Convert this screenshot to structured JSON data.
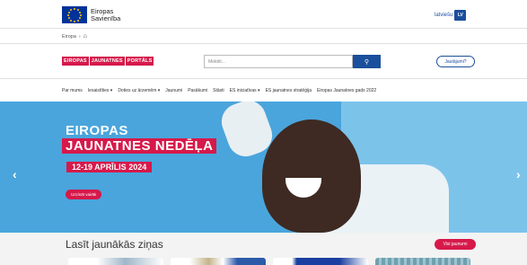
{
  "header": {
    "eu_logo_line1": "Eiropas",
    "eu_logo_line2": "Savienība",
    "language": "latviešu",
    "language_code": "LV"
  },
  "breadcrumb": {
    "root": "Eiropa",
    "separator": "›"
  },
  "portal": {
    "logo_words": [
      "EIROPAS",
      "JAUNATNES",
      "PORTĀLS"
    ],
    "search_placeholder": "Meklēt...",
    "questions_label": "Jautājumi?"
  },
  "nav": {
    "items": [
      "Par mums",
      "Iesaistīties ▾",
      "Doties uz ārzemēm ▾",
      "Jaunumi",
      "Pasākumi",
      "Stāsti",
      "ES iniciatīvas ▾",
      "ES jaunatnes stratēģija",
      "Eiropas Jaunatnes gads 2022"
    ]
  },
  "hero": {
    "title_line1": "EIROPAS",
    "title_line2": "JAUNATNES NEDĒĻA",
    "date": "12-19 APRĪLIS 2024",
    "cta": "Uzzināt vairāk",
    "prev_arrow": "‹",
    "next_arrow": "›"
  },
  "news": {
    "title": "Lasīt jaunākās ziņas",
    "all_label": "Visi jaunumi"
  },
  "colors": {
    "brand_red": "#d6194a",
    "eu_blue": "#003399",
    "link_blue": "#1a4f9c",
    "hero_blue": "#4aa5dc"
  }
}
